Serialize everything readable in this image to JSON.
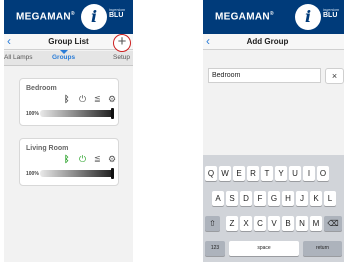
{
  "left": {
    "brand": {
      "name": "MEGAMAN",
      "reg": "®",
      "small_text": "ingenium",
      "blu": "BLU"
    },
    "nav": {
      "back": "‹",
      "title": "Group List"
    },
    "add_button": "+",
    "tabs": [
      {
        "label": "All Lamps",
        "active": false
      },
      {
        "label": "Groups",
        "active": true
      },
      {
        "label": "Setup",
        "active": false
      }
    ],
    "groups": [
      {
        "name": "Bedroom",
        "brightness_label": "100%",
        "brightness": 1.0,
        "bluetooth_icon": "bluetooth-icon",
        "power_icon": "power-icon",
        "scene_icon": "scene-icon",
        "settings_icon": "gear-icon",
        "power_on": false
      },
      {
        "name": "Living Room",
        "brightness_label": "100%",
        "brightness": 1.0,
        "bluetooth_icon": "bluetooth-icon",
        "power_icon": "power-icon",
        "scene_icon": "scene-icon",
        "settings_icon": "gear-icon",
        "power_on": true
      }
    ]
  },
  "right": {
    "brand": {
      "name": "MEGAMAN",
      "reg": "®",
      "small_text": "ingenium",
      "blu": "BLU"
    },
    "nav": {
      "back": "‹",
      "title": "Add Group"
    },
    "input": {
      "value": "Bedroom"
    },
    "clear_label": "×",
    "keyboard": {
      "row1": [
        "Q",
        "W",
        "E",
        "R",
        "T",
        "Y",
        "U",
        "I",
        "O"
      ],
      "row2": [
        "A",
        "S",
        "D",
        "F",
        "G",
        "H",
        "J",
        "K",
        "L"
      ],
      "row3": [
        "Z",
        "X",
        "C",
        "V",
        "B",
        "N",
        "M"
      ],
      "shift": "⇧",
      "backspace": "⌫",
      "numbers": "123",
      "space": "space",
      "return": "return"
    }
  },
  "colors": {
    "brand_bar": "#003b7a",
    "accent": "#2a7cd7",
    "power_on": "#2fa52f",
    "highlight_circle": "#cc1f1f"
  }
}
